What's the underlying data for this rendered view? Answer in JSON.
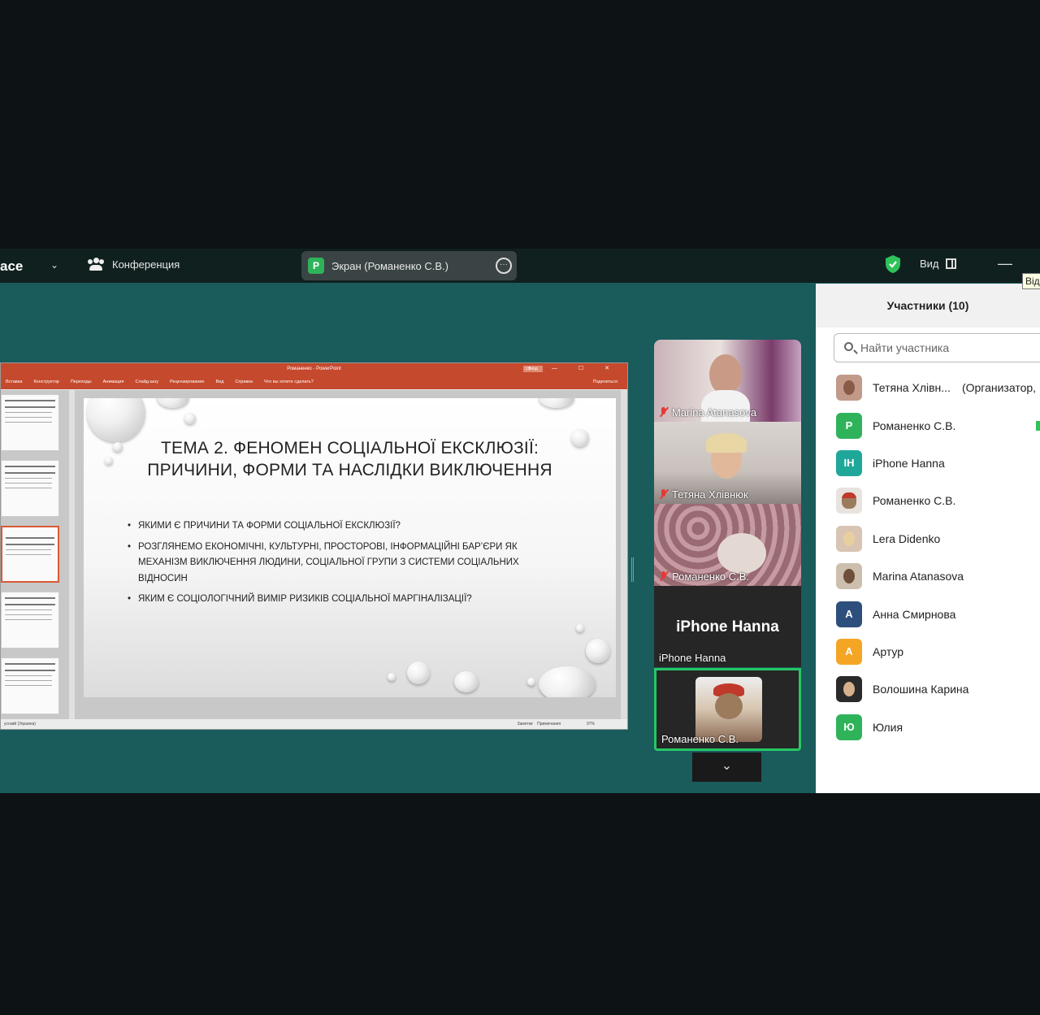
{
  "topbar": {
    "app_name_fragment": "ace",
    "conference_label": "Конференция",
    "screen_share_label": "Экран (Романенко С.В.)",
    "screen_share_badge": "P",
    "view_label": "Вид",
    "tooltip_fragment": "Від"
  },
  "shared_screen": {
    "window_title": "Романенко - PowerPoint",
    "signin_label": "Вход",
    "ribbon_tabs": [
      "Вставка",
      "Конструктор",
      "Переходы",
      "Анимация",
      "Слайд-шоу",
      "Рецензирование",
      "Вид",
      "Справка",
      "Что вы хотите сделать?"
    ],
    "share_label": "Поделиться",
    "slide": {
      "title_line1": "ТЕМА 2.  ФЕНОМЕН СОЦІАЛЬНОЇ ЕКСКЛЮЗІЇ:",
      "title_line2": "ПРИЧИНИ, ФОРМИ ТА НАСЛІДКИ ВИКЛЮЧЕННЯ",
      "bullets": [
        "ЯКИМИ Є ПРИЧИНИ ТА ФОРМИ СОЦІАЛЬНОЇ ЕКСКЛЮЗІЇ?",
        "РОЗГЛЯНЕМО ЕКОНОМІЧНІ, КУЛЬТУРНІ, ПРОСТОРОВІ, ІНФОРМАЦІЙНІ БАР’ЄРИ ЯК МЕХАНІЗМ ВИКЛЮЧЕННЯ ЛЮДИНИ, СОЦІАЛЬНОЇ ГРУПИ З СИСТЕМИ СОЦІАЛЬНИХ ВІДНОСИН",
        "ЯКИМ Є СОЦІОЛОГІЧНИЙ ВИМІР РИЗИКІВ СОЦІАЛЬНОЇ МАРГІНАЛІЗАЦІЇ?"
      ]
    },
    "status_left": "усский (Украина)",
    "status_notes": "Заметки",
    "status_comments": "Примечания",
    "zoom": "97%"
  },
  "video_tiles": [
    {
      "name": "Marina Atanasova",
      "muted": true
    },
    {
      "name": "Тетяна Хлівнюк",
      "muted": true
    },
    {
      "name": "Романенко С.В.",
      "muted": true
    },
    {
      "name": "iPhone Hanna",
      "big_label": "iPhone Hanna",
      "muted": false
    },
    {
      "name": "Романенко С.В.",
      "muted": false,
      "active_speaker": true
    }
  ],
  "participants": {
    "header": "Участники (10)",
    "search_placeholder": "Найти участника",
    "list": [
      {
        "name": "Тетяна Хлівн...",
        "role": "(Организатор,",
        "avatar": "photo",
        "color": "#b07a6a"
      },
      {
        "name": "Романенко С.В.",
        "avatar": "Р",
        "color": "#2fb35a",
        "speaking": true
      },
      {
        "name": "iPhone Hanna",
        "avatar": "IH",
        "color": "#1fa89a"
      },
      {
        "name": "Романенко С.В.",
        "avatar": "photo",
        "color": "#a0785c"
      },
      {
        "name": "Lera Didenko",
        "avatar": "photo",
        "color": "#c9a889"
      },
      {
        "name": "Marina Atanasova",
        "avatar": "photo",
        "color": "#9a7a60"
      },
      {
        "name": "Анна Смирнова",
        "avatar": "А",
        "color": "#2d4f7c"
      },
      {
        "name": "Артур",
        "avatar": "А",
        "color": "#f5a524"
      },
      {
        "name": "Волошина Карина",
        "avatar": "photo",
        "color": "#3a3a3a"
      },
      {
        "name": "Юлия",
        "avatar": "Ю",
        "color": "#2fb35a"
      }
    ]
  }
}
